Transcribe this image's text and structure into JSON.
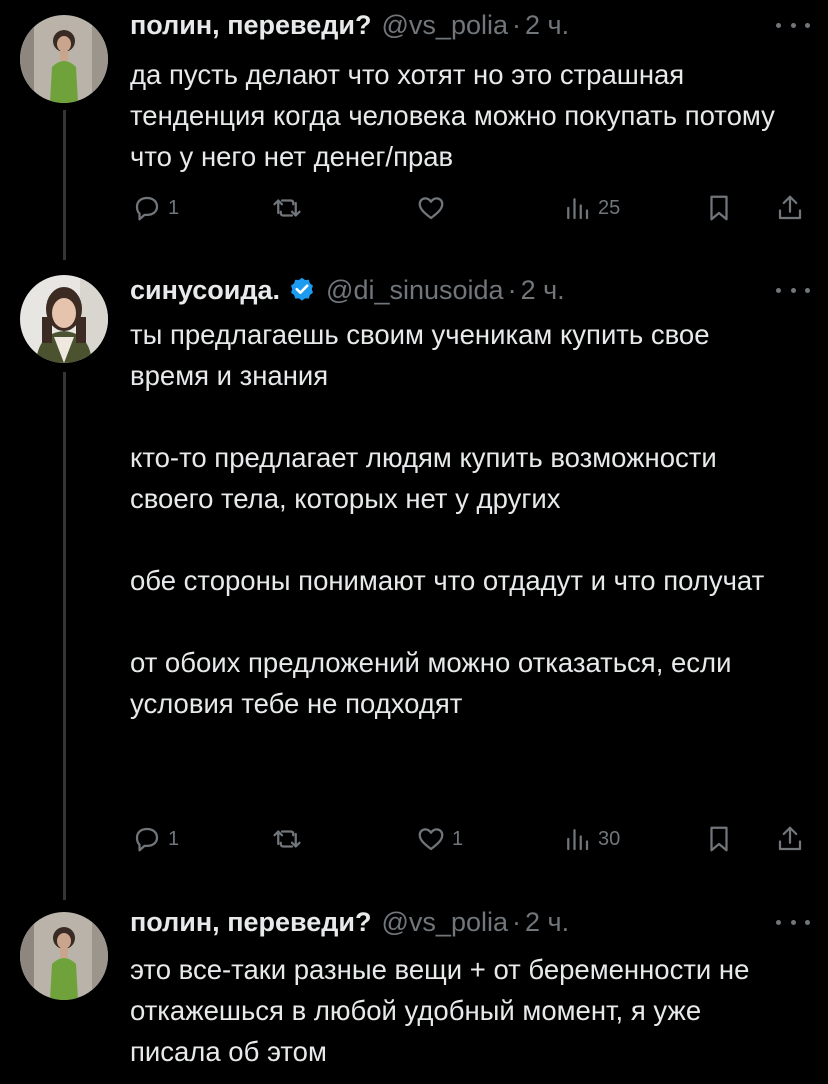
{
  "tweets": [
    {
      "name": "полин, переведи?",
      "handle": "@vs_polia",
      "sep": "·",
      "time": "2 ч.",
      "verified": false,
      "paragraphs": [
        "да пусть делают что хотят но это страшная тенденция когда человека можно покупать потому что у него нет денег/прав"
      ],
      "replies": "1",
      "retweets": "",
      "likes": "",
      "views": "25"
    },
    {
      "name": "синусоида.",
      "handle": "@di_sinusoida",
      "sep": "·",
      "time": "2 ч.",
      "verified": true,
      "paragraphs": [
        "ты предлагаешь своим ученикам купить свое время и знания",
        "кто-то предлагает людям купить возможности своего тела, которых нет у других",
        "обе стороны понимают что отдадут и что получат",
        "от обоих предложений можно отказаться, если условия тебе не подходят"
      ],
      "replies": "1",
      "retweets": "",
      "likes": "1",
      "views": "30"
    },
    {
      "name": "полин, переведи?",
      "handle": "@vs_polia",
      "sep": "·",
      "time": "2 ч.",
      "verified": false,
      "paragraphs": [
        "это все-таки разные вещи + от беременности не откажешься в любой удобный момент, я уже писала об этом"
      ],
      "replies": "",
      "retweets": "",
      "likes": "",
      "views": ""
    }
  ],
  "icons": {
    "reply": "reply-icon",
    "retweet": "retweet-icon",
    "like": "heart-icon",
    "views": "views-icon",
    "bookmark": "bookmark-icon",
    "share": "share-icon",
    "more": "more-icon",
    "verified": "verified-badge-icon"
  },
  "colors": {
    "background": "#000000",
    "text": "#e7e9ea",
    "secondary": "#71767b",
    "verified": "#1d9bf0",
    "thread_line": "#333639"
  }
}
